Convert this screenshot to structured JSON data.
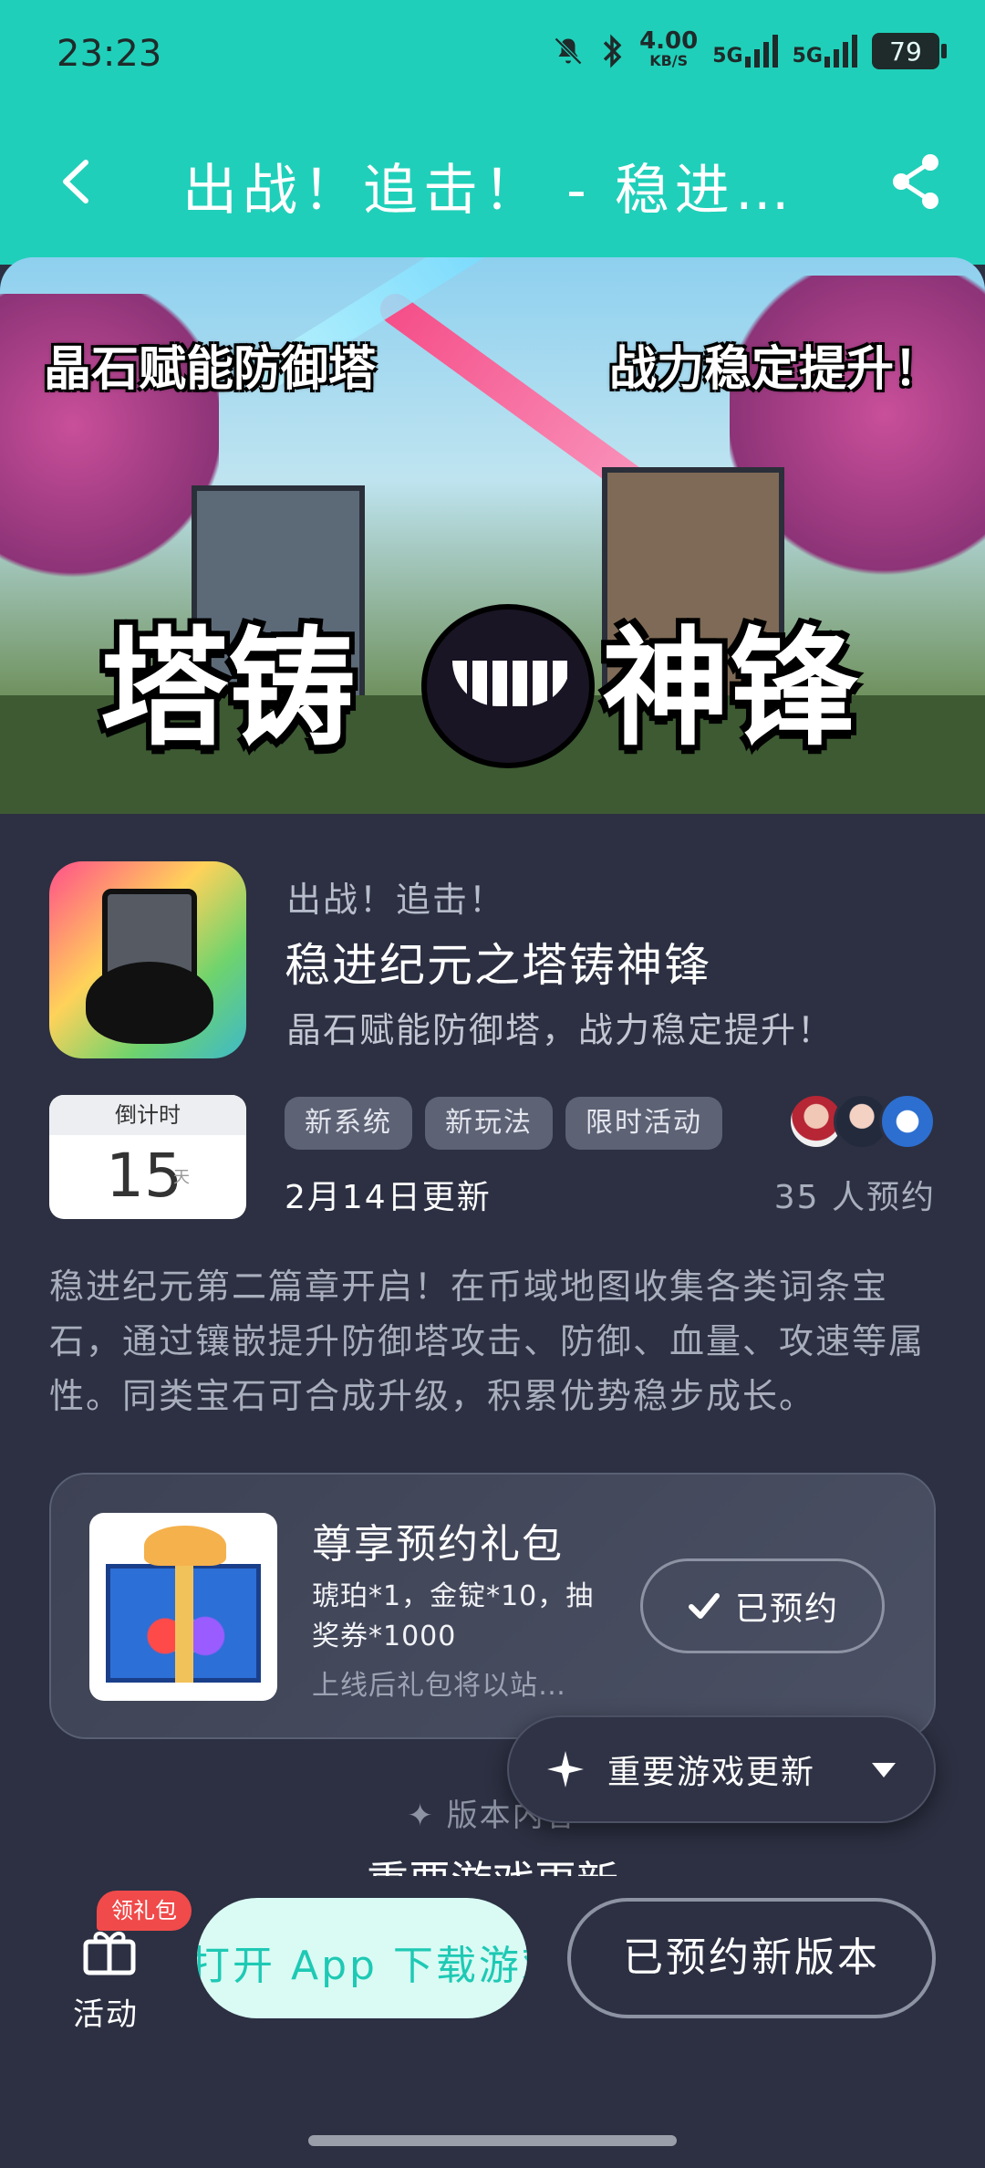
{
  "status_bar": {
    "time": "23:23",
    "net_speed_value": "4.00",
    "net_speed_unit": "KB/S",
    "sim1": "5G",
    "sim2": "5G",
    "battery": "79"
  },
  "header": {
    "title": "出战！追击！ - 稳进…",
    "background": "#20cfb9"
  },
  "banner": {
    "tag_left": "晶石赋能防御塔",
    "tag_right": "战力稳定提升！",
    "title_left": "塔铸",
    "title_right": "神锋"
  },
  "game": {
    "subtitle": "出战！追击！",
    "name": "稳进纪元之塔铸神锋",
    "tagline": "晶石赋能防御塔，战力稳定提升！",
    "countdown_label": "倒计时",
    "countdown_value": "15",
    "countdown_unit": "天",
    "tags": [
      "新系统",
      "新玩法",
      "限时活动"
    ],
    "update_date": "2月14日更新",
    "reserve_count": "35 人预约",
    "description": "稳进纪元第二篇章开启！在币域地图收集各类词条宝石，通过镶嵌提升防御塔攻击、防御、血量、攻速等属性。同类宝石可合成升级，积累优势稳步成长。"
  },
  "gift": {
    "title": "尊享预约礼包",
    "content": "琥珀*1，金锭*10，抽奖券*1000",
    "note": "上线后礼包将以站…",
    "button": "已预约"
  },
  "section": {
    "label": "版本内容",
    "title": "重要游戏更新"
  },
  "floating": {
    "label": "重要游戏更新"
  },
  "bottom": {
    "activity_label": "活动",
    "badge": "领礼包",
    "open_app": "打开 App 下载游戏",
    "reserved_version": "已预约新版本"
  },
  "colors": {
    "accent": "#20cfb9",
    "background": "#2c3042",
    "badge": "#f04a4a"
  }
}
